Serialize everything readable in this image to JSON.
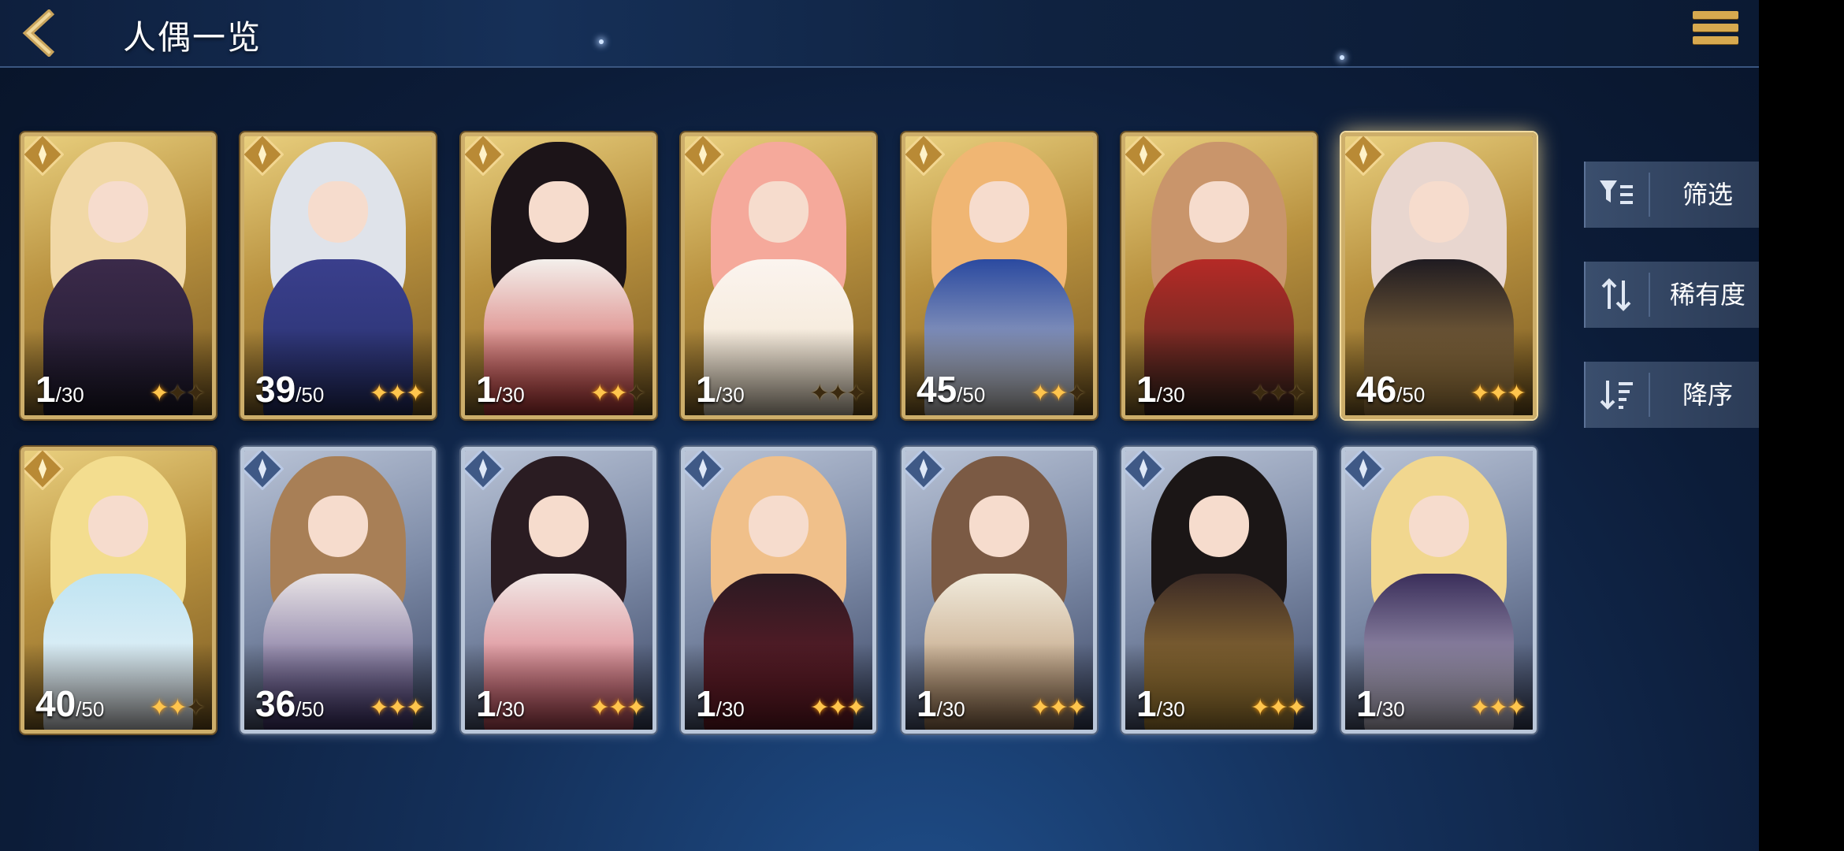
{
  "header": {
    "title": "人偶一览"
  },
  "side_buttons": [
    {
      "label": "筛选",
      "icon": "filter-icon"
    },
    {
      "label": "稀有度",
      "icon": "sort-arrows-icon"
    },
    {
      "label": "降序",
      "icon": "sort-descending-icon"
    }
  ],
  "colors": {
    "gold_frame": "#cdae6a",
    "silver_frame": "#b9c6d9",
    "star_on": "#ffc54d",
    "menu_gold": "#d7a94f"
  },
  "cards": [
    {
      "level": "1",
      "max": "/30",
      "stars_on": 1,
      "stars_total": 3,
      "frame": "gold",
      "emblem": "emblem-icon"
    },
    {
      "level": "39",
      "max": "/50",
      "stars_on": 3,
      "stars_total": 3,
      "frame": "gold",
      "emblem": "emblem-icon"
    },
    {
      "level": "1",
      "max": "/30",
      "stars_on": 2,
      "stars_total": 3,
      "frame": "gold",
      "emblem": "emblem-icon"
    },
    {
      "level": "1",
      "max": "/30",
      "stars_on": 0,
      "stars_total": 3,
      "frame": "gold",
      "emblem": "emblem-icon"
    },
    {
      "level": "45",
      "max": "/50",
      "stars_on": 2,
      "stars_total": 3,
      "frame": "gold",
      "emblem": "emblem-icon"
    },
    {
      "level": "1",
      "max": "/30",
      "stars_on": 0,
      "stars_total": 3,
      "frame": "gold",
      "emblem": "emblem-icon"
    },
    {
      "level": "46",
      "max": "/50",
      "stars_on": 3,
      "stars_total": 3,
      "frame": "gold",
      "emblem": "emblem-icon",
      "selected": true
    },
    {
      "level": "40",
      "max": "/50",
      "stars_on": 2,
      "stars_total": 3,
      "frame": "gold",
      "emblem": "emblem-icon"
    },
    {
      "level": "36",
      "max": "/50",
      "stars_on": 3,
      "stars_total": 3,
      "frame": "silver",
      "emblem": "emblem-icon"
    },
    {
      "level": "1",
      "max": "/30",
      "stars_on": 3,
      "stars_total": 3,
      "frame": "silver",
      "emblem": "emblem-icon"
    },
    {
      "level": "1",
      "max": "/30",
      "stars_on": 3,
      "stars_total": 3,
      "frame": "silver",
      "emblem": "emblem-icon"
    },
    {
      "level": "1",
      "max": "/30",
      "stars_on": 3,
      "stars_total": 3,
      "frame": "silver",
      "emblem": "emblem-icon"
    },
    {
      "level": "1",
      "max": "/30",
      "stars_on": 3,
      "stars_total": 3,
      "frame": "silver",
      "emblem": "emblem-icon"
    },
    {
      "level": "1",
      "max": "/30",
      "stars_on": 3,
      "stars_total": 3,
      "frame": "silver",
      "emblem": "emblem-icon"
    }
  ]
}
